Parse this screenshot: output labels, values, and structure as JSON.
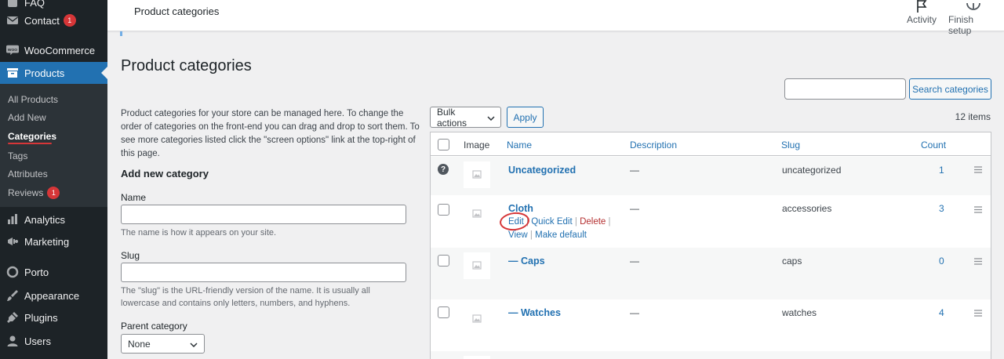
{
  "sidebar": {
    "top_partial": "FAQ",
    "items": [
      {
        "label": "Contact",
        "icon": "mail-icon",
        "badge": "1"
      },
      {
        "label": "WooCommerce",
        "icon": "woo-icon"
      },
      {
        "label": "Products",
        "icon": "archive-icon",
        "active": true
      },
      {
        "label": "Analytics",
        "icon": "bar-chart-icon"
      },
      {
        "label": "Marketing",
        "icon": "megaphone-icon"
      },
      {
        "label": "Porto",
        "icon": "circle-icon"
      },
      {
        "label": "Appearance",
        "icon": "brush-icon"
      },
      {
        "label": "Plugins",
        "icon": "plug-icon"
      },
      {
        "label": "Users",
        "icon": "user-icon"
      }
    ],
    "submenu": [
      {
        "label": "All Products"
      },
      {
        "label": "Add New"
      },
      {
        "label": "Categories",
        "current": true
      },
      {
        "label": "Tags"
      },
      {
        "label": "Attributes"
      },
      {
        "label": "Reviews",
        "badge": "1"
      }
    ]
  },
  "topbar": {
    "title": "Product categories",
    "activity_label": "Activity",
    "finish_label": "Finish setup"
  },
  "page": {
    "title": "Product categories",
    "intro": "Product categories for your store can be managed here. To change the order of categories on the front-end you can drag and drop to sort them. To see more categories listed click the \"screen options\" link at the top-right of this page."
  },
  "search": {
    "value": "",
    "button_label": "Search categories"
  },
  "form": {
    "title": "Add new category",
    "name_label": "Name",
    "name_value": "",
    "name_help": "The name is how it appears on your site.",
    "slug_label": "Slug",
    "slug_value": "",
    "slug_help": "The \"slug\" is the URL-friendly version of the name. It is usually all lowercase and contains only letters, numbers, and hyphens.",
    "parent_label": "Parent category",
    "parent_value": "None"
  },
  "table": {
    "bulk_value": "Bulk actions",
    "apply_label": "Apply",
    "items_count": "12 items",
    "headers": {
      "image": "Image",
      "name": "Name",
      "description": "Description",
      "slug": "Slug",
      "count": "Count"
    },
    "rows": [
      {
        "name": "Uncategorized",
        "description": "—",
        "slug": "uncategorized",
        "count": "1"
      },
      {
        "name": "Cloth",
        "description": "—",
        "slug": "accessories",
        "count": "3"
      },
      {
        "name": "— Caps",
        "description": "—",
        "slug": "caps",
        "count": "0"
      },
      {
        "name": "— Watches",
        "description": "—",
        "slug": "watches",
        "count": "4"
      }
    ],
    "row_actions": {
      "edit": "Edit",
      "quick_edit": "Quick Edit",
      "delete": "Delete",
      "view": "View",
      "make_default": "Make default",
      "sep": "|"
    }
  },
  "colors": {
    "sidebar_bg": "#1d2327",
    "accent": "#2271b1",
    "badge": "#d63638",
    "annotation_red": "#d63638"
  }
}
